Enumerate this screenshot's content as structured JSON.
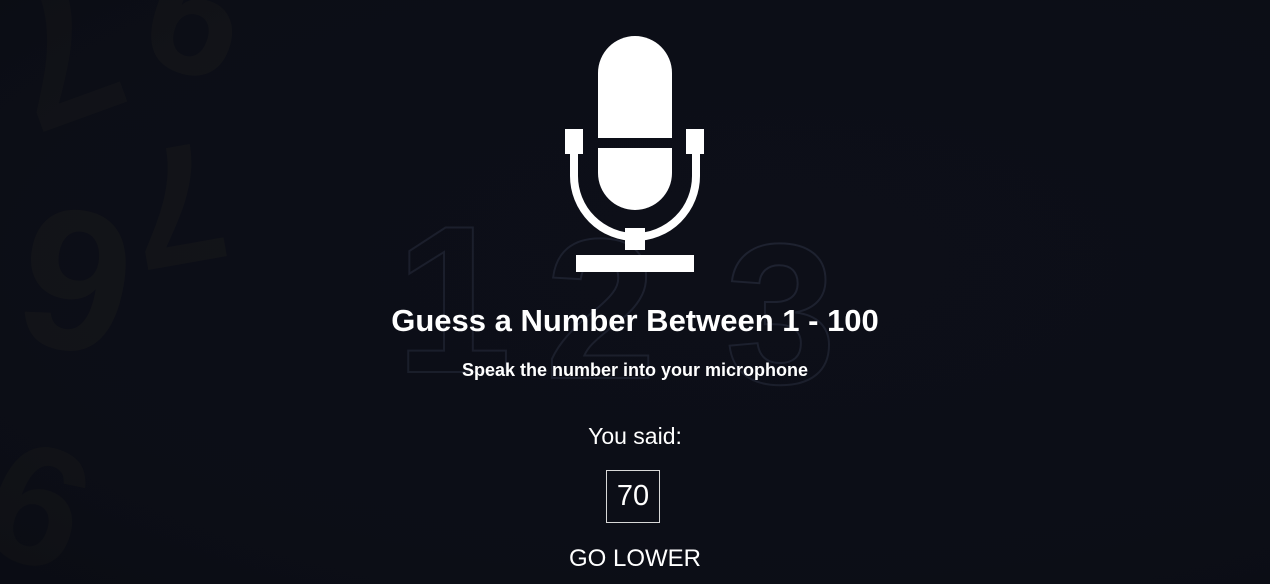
{
  "background": {
    "color": "#0d0f18",
    "digits_scattered": [
      "9",
      "1",
      "2",
      "3",
      "6",
      "9"
    ]
  },
  "header": {
    "mic_icon": "microphone-icon",
    "title": "Guess a Number Between 1 - 100",
    "subtitle": "Speak the number into your microphone"
  },
  "result": {
    "label": "You said:",
    "value": "70",
    "feedback": "GO LOWER"
  },
  "colors": {
    "text": "#ffffff",
    "box_border": "#d8d8d8"
  }
}
